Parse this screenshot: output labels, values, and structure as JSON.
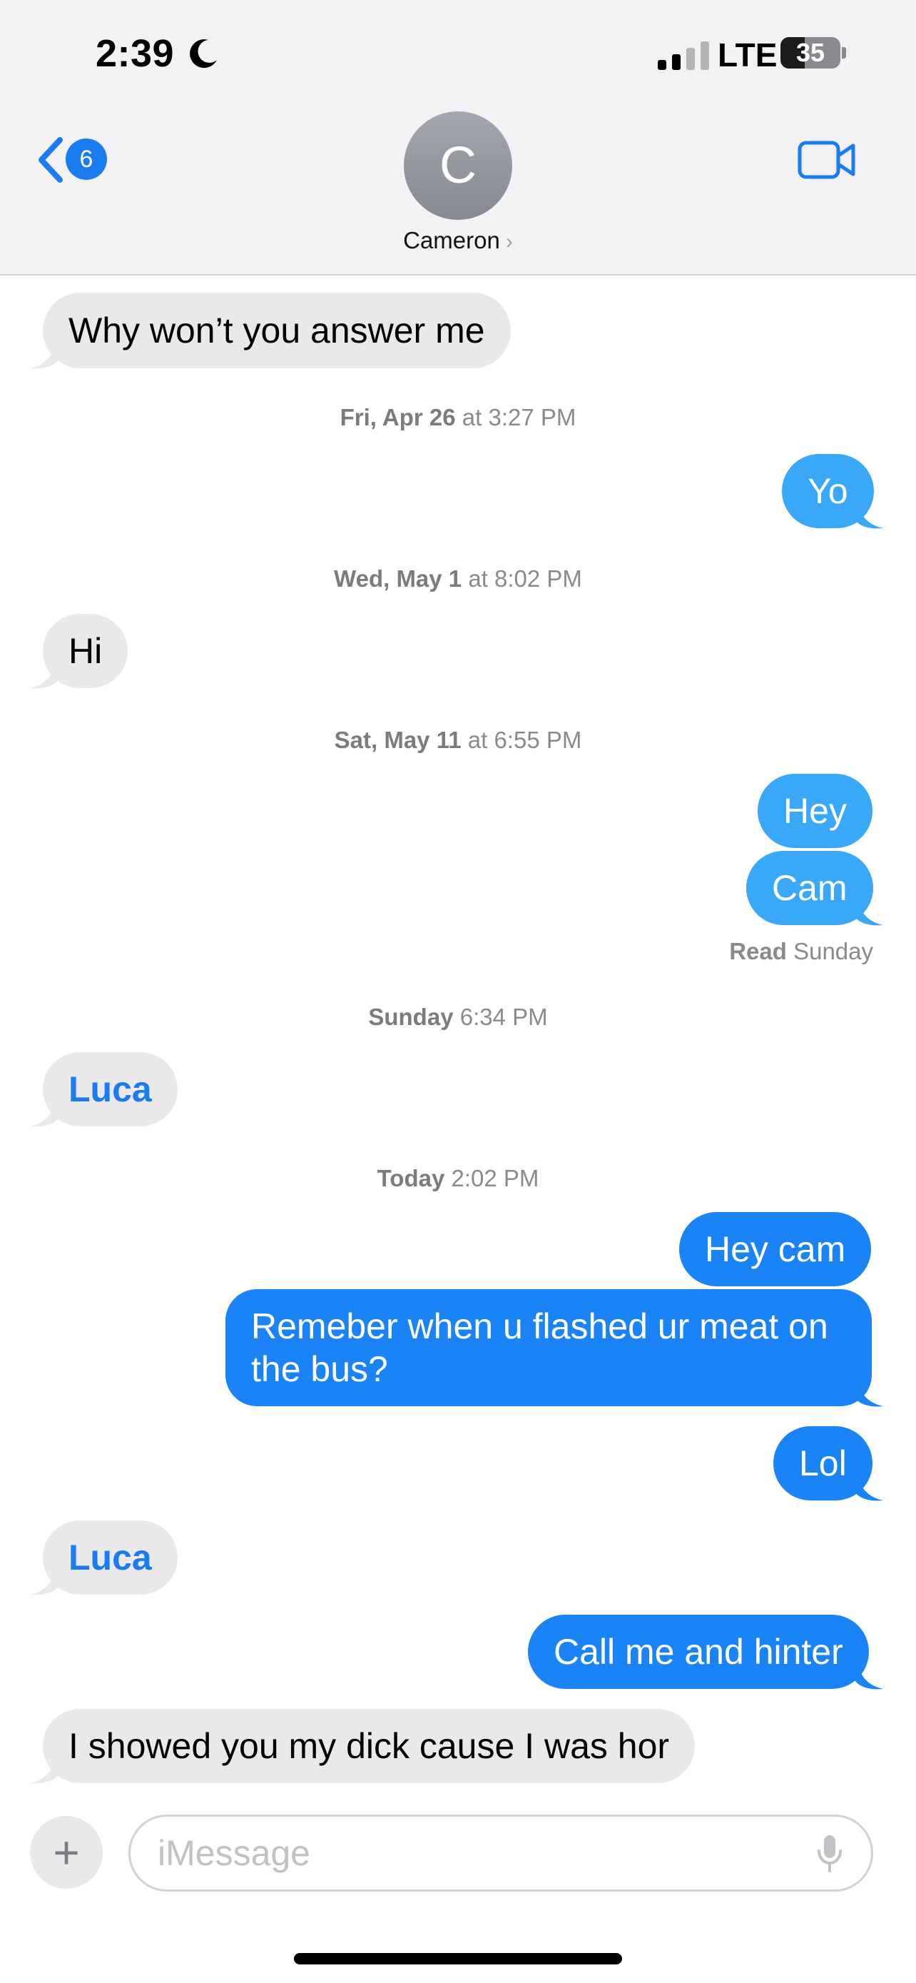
{
  "status": {
    "time": "2:39",
    "network": "LTE",
    "battery": "35"
  },
  "nav": {
    "unread_count": "6",
    "avatar_initial": "C",
    "contact_name": "Cameron",
    "chevron": "›"
  },
  "messages": [
    {
      "text": "Why won’t you answer me"
    },
    {
      "text": "Fri, Apr 26",
      "at": " at 3:27 PM"
    },
    {
      "text": "Yo"
    },
    {
      "text": "Wed, May 1",
      "at": " at 8:02 PM"
    },
    {
      "text": "Hi"
    },
    {
      "text": "Sat, May 11",
      "at": " at 6:55 PM"
    },
    {
      "text": "Hey"
    },
    {
      "text": "Cam"
    },
    {
      "read_label": "Read",
      "read_when": " Sunday"
    },
    {
      "text": "Sunday",
      "at": " 6:34 PM"
    },
    {
      "text": "Luca"
    },
    {
      "text": "Today",
      "at": " 2:02 PM"
    },
    {
      "text": "Hey cam"
    },
    {
      "line1": "Remeber when u flashed ur meat on",
      "line2": "the bus?"
    },
    {
      "text": "Lol"
    },
    {
      "text": "Luca"
    },
    {
      "text": "Call me and hinter"
    },
    {
      "text": "I showed you my dick cause I was hor"
    }
  ],
  "composer": {
    "placeholder": "iMessage",
    "plus_label": "+"
  },
  "colors": {
    "outgoing": "#1a84f7",
    "outgoing_light": "#3aa8f8",
    "incoming": "#e9e9eb",
    "link": "#1a7cf0"
  }
}
